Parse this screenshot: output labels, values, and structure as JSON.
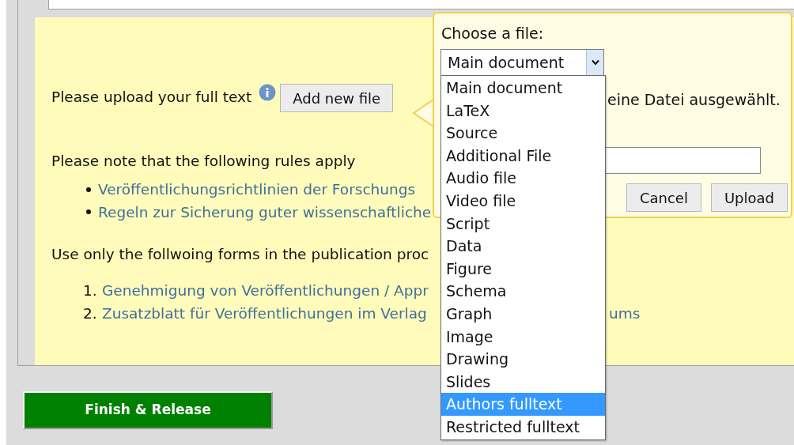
{
  "upload": {
    "label": "Please upload your full text",
    "button": "Add new file"
  },
  "rules": {
    "heading": "Please note that the following rules apply",
    "links": [
      "Veröffentlichungsrichtlinien der Forschungs",
      "Regeln zur Sicherung guter wissenschaftliche"
    ]
  },
  "forms": {
    "heading": "Use only the follwoing forms in the publication proc",
    "items": [
      {
        "number": "1.",
        "parts": [
          "Genehmigung von Veröffentlichungen / Appr"
        ]
      },
      {
        "number": "2.",
        "parts": [
          "Zusatzblatt für Veröffentlichungen im Verlag",
          "ums"
        ]
      }
    ]
  },
  "finish_button": "Finish & Release",
  "popup": {
    "label": "Choose a file:",
    "select": {
      "value": "Main document",
      "options": [
        {
          "label": "Main document",
          "highlighted": false
        },
        {
          "label": "LaTeX",
          "highlighted": false
        },
        {
          "label": "Source",
          "highlighted": false
        },
        {
          "label": "Additional File",
          "highlighted": false
        },
        {
          "label": "Audio file",
          "highlighted": false
        },
        {
          "label": "Video file",
          "highlighted": false
        },
        {
          "label": "Script",
          "highlighted": false
        },
        {
          "label": "Data",
          "highlighted": false
        },
        {
          "label": "Figure",
          "highlighted": false
        },
        {
          "label": "Schema",
          "highlighted": false
        },
        {
          "label": "Graph",
          "highlighted": false
        },
        {
          "label": "Image",
          "highlighted": false
        },
        {
          "label": "Drawing",
          "highlighted": false
        },
        {
          "label": "Slides",
          "highlighted": false
        },
        {
          "label": "Authors fulltext",
          "highlighted": true
        },
        {
          "label": "Restricted fulltext",
          "highlighted": false
        }
      ]
    },
    "file_status": "eine Datei ausgewählt.",
    "buttons": [
      "Cancel",
      "Upload"
    ]
  }
}
